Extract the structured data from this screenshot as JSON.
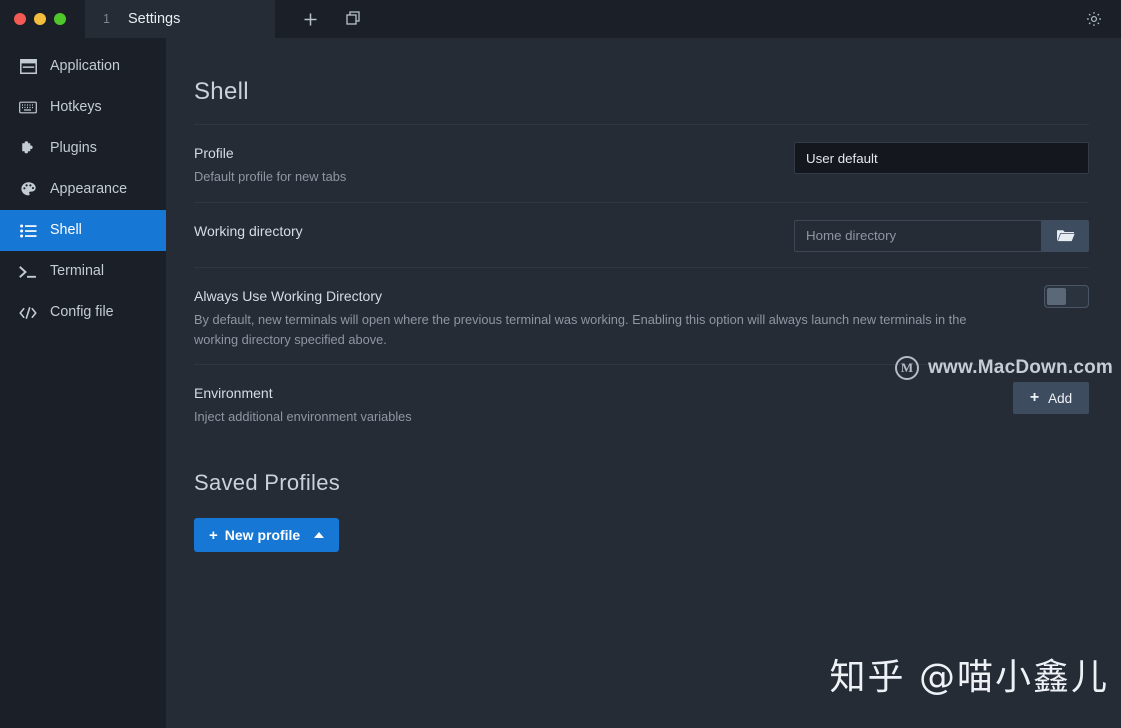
{
  "window": {
    "traffic_lights": [
      "close",
      "minimize",
      "zoom"
    ],
    "tab": {
      "index": "1",
      "title": "Settings"
    },
    "actions": {
      "new_tab": "+",
      "split": "panes"
    },
    "settings_icon": "gear"
  },
  "sidebar": {
    "items": [
      {
        "label": "Application",
        "icon": "window-icon",
        "active": false
      },
      {
        "label": "Hotkeys",
        "icon": "keyboard-icon",
        "active": false
      },
      {
        "label": "Plugins",
        "icon": "puzzle-icon",
        "active": false
      },
      {
        "label": "Appearance",
        "icon": "palette-icon",
        "active": false
      },
      {
        "label": "Shell",
        "icon": "list-icon",
        "active": true
      },
      {
        "label": "Terminal",
        "icon": "prompt-icon",
        "active": false
      },
      {
        "label": "Config file",
        "icon": "code-icon",
        "active": false
      }
    ]
  },
  "main": {
    "page_title": "Shell",
    "rows": [
      {
        "label": "Profile",
        "desc": "Default profile for new tabs",
        "control": "select",
        "value": "User default"
      },
      {
        "label": "Working directory",
        "desc": "",
        "control": "input",
        "placeholder": "Home directory",
        "value": "",
        "browse_icon": "folder-icon"
      },
      {
        "label": "Always Use Working Directory",
        "desc": "By default, new terminals will open where the previous terminal was working. Enabling this option will always launch new terminals in the working directory specified above.",
        "control": "toggle",
        "enabled": false
      },
      {
        "label": "Environment",
        "desc": "Inject additional environment variables",
        "control": "button",
        "button_label": "Add",
        "button_icon": "plus-icon"
      }
    ],
    "saved_profiles": {
      "title": "Saved Profiles",
      "new_profile_label": "New profile",
      "new_profile_icon": "plus-icon",
      "caret": "caret-up-icon"
    }
  },
  "watermarks": {
    "macdown": "www.MacDown.com",
    "macdown_logo": "M",
    "zhihu": "知乎 @喵小鑫儿"
  },
  "colors": {
    "accent": "#1677d5",
    "sidebar_bg": "#1b2028",
    "main_bg": "#252c35",
    "titlebar_bg": "#1b2028",
    "button_muted": "#3e4c60"
  }
}
